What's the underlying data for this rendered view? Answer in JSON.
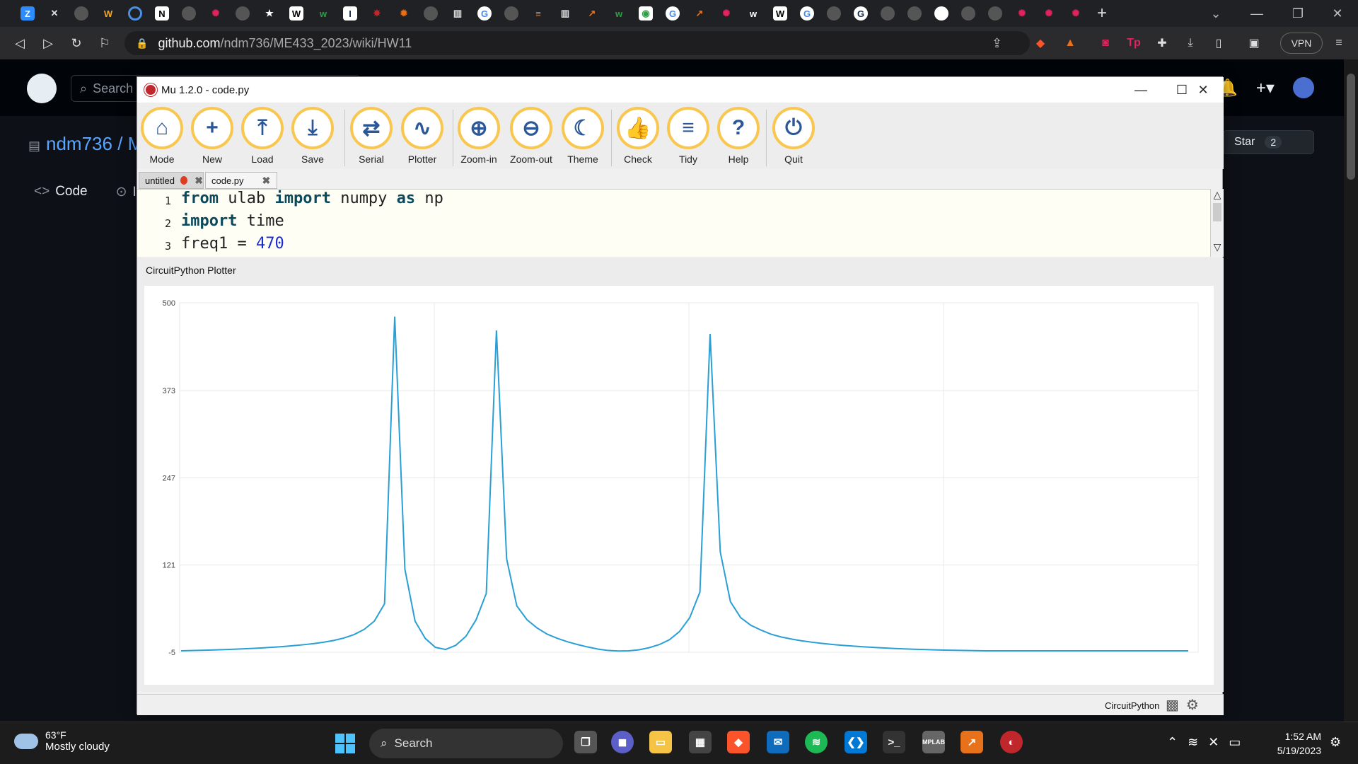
{
  "browser": {
    "url_host": "github.com",
    "url_path": "/ndm736/ME433_2023/wiki/HW11",
    "vpn_label": "VPN",
    "new_tab_symbol": "+"
  },
  "github": {
    "search_label": "Search",
    "repo_label": "ndm736 / M",
    "tabs": [
      "Code",
      "Is"
    ],
    "star_label": "Star",
    "star_count": "2"
  },
  "mu": {
    "window_title": "Mu 1.2.0 - code.py",
    "toolbar": [
      {
        "label": "Mode",
        "icon": "mode-icon"
      },
      {
        "label": "New",
        "icon": "plus-icon"
      },
      {
        "label": "Load",
        "icon": "upload-icon"
      },
      {
        "label": "Save",
        "icon": "download-icon"
      },
      {
        "label": "Serial",
        "icon": "swap-arrows-icon"
      },
      {
        "label": "Plotter",
        "icon": "pulse-icon"
      },
      {
        "label": "Zoom-in",
        "icon": "zoom-in-icon"
      },
      {
        "label": "Zoom-out",
        "icon": "zoom-out-icon"
      },
      {
        "label": "Theme",
        "icon": "moon-icon"
      },
      {
        "label": "Check",
        "icon": "thumbs-up-icon"
      },
      {
        "label": "Tidy",
        "icon": "lines-icon"
      },
      {
        "label": "Help",
        "icon": "question-icon"
      },
      {
        "label": "Quit",
        "icon": "power-icon"
      }
    ],
    "tabs": [
      {
        "label": "untitled",
        "unsaved": true
      },
      {
        "label": "code.py",
        "unsaved": false
      }
    ],
    "code_lines": [
      {
        "num": "1",
        "tokens": [
          [
            "kw",
            "from"
          ],
          [
            "",
            " ulab "
          ],
          [
            "kw",
            "import"
          ],
          [
            "",
            " numpy "
          ],
          [
            "kw",
            "as"
          ],
          [
            "",
            " np"
          ]
        ]
      },
      {
        "num": "2",
        "tokens": [
          [
            "kw",
            "import"
          ],
          [
            "",
            " time"
          ]
        ]
      },
      {
        "num": "3",
        "tokens": [
          [
            "",
            "freq1 = "
          ],
          [
            "num",
            "470"
          ]
        ]
      }
    ],
    "plotter_title": "CircuitPython Plotter",
    "status_mode": "CircuitPython"
  },
  "chart_data": {
    "type": "line",
    "title": "",
    "xlabel": "",
    "ylabel": "",
    "ylim": [
      -5,
      500
    ],
    "yticks": [
      -5,
      121,
      247,
      373,
      500
    ],
    "color": "#2a9fd6",
    "series": [
      {
        "values": [
          -3,
          -2.6,
          -2.2,
          -1.8,
          -1.3,
          -0.8,
          -0.2,
          0.5,
          1.3,
          2.2,
          3.2,
          4.4,
          5.8,
          7.4,
          9.4,
          12,
          15.5,
          20.5,
          28,
          40,
          65,
          480,
          115,
          40,
          15,
          2,
          -1,
          5,
          18,
          42,
          80,
          460,
          130,
          62,
          42,
          30,
          21,
          15,
          10,
          6,
          2.5,
          -0.5,
          -2.5,
          -3.2,
          -3,
          -1.5,
          1.5,
          6,
          13,
          25,
          45,
          82,
          455,
          140,
          68,
          45,
          34,
          27,
          21,
          17,
          14,
          11.5,
          9.5,
          7.8,
          6.3,
          5,
          3.9,
          2.9,
          2,
          1.2,
          0.5,
          -0.1,
          -0.6,
          -1.1,
          -1.5,
          -1.9,
          -2.2,
          -2.5,
          -2.7,
          -2.9,
          -3,
          -3,
          -3,
          -3,
          -3,
          -3,
          -3,
          -3,
          -3,
          -3,
          -3,
          -3,
          -3,
          -3,
          -3,
          -3,
          -3,
          -3,
          -3,
          -3
        ]
      }
    ],
    "grid": true
  },
  "taskbar": {
    "temp": "63°F",
    "weather": "Mostly cloudy",
    "search_label": "Search",
    "time": "1:52 AM",
    "date": "5/19/2023"
  }
}
